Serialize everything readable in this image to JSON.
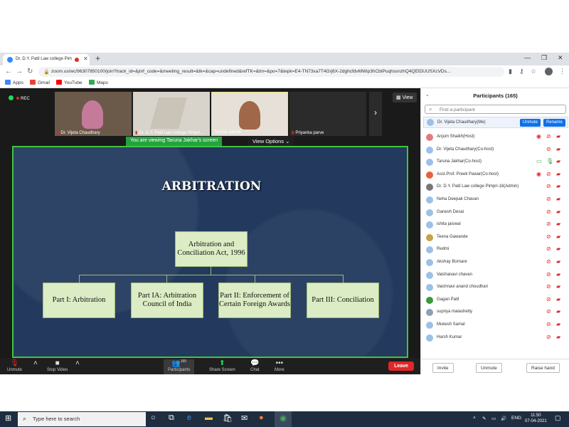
{
  "browser": {
    "tab_title": "Dr. D.Y. Patil Law college Pim",
    "new_tab": "+",
    "url": "zoom.us/wc/96307850100/join?track_id=&jmf_code=&meeting_result=&tk=&cap=undefined&refTK=&tm=&po=7&tepk=E4-TN73xa7T4Grj6X-2dghcfdvMWip3hCbtPuqhssnzhQ4QEIDUUSXcVDs...",
    "bookmarks": [
      "Apps",
      "Gmail",
      "YouTube",
      "Maps"
    ]
  },
  "meeting": {
    "rec_label": "REC",
    "view_label": "View",
    "viewing_banner": "You are viewing Taruna Jakhar's screen",
    "view_options": "View Options ⌄",
    "thumbnails": [
      {
        "name": "Dr. Vijeta Chaudhary"
      },
      {
        "name": "Dr. D.Y. Patil Law college Pimpri..."
      },
      {
        "name": "Taruna Jakhar"
      },
      {
        "name": "Priyanka parve"
      }
    ]
  },
  "slide": {
    "title": "ARBITRATION",
    "root": "Arbitration and Conciliation Act, 1996",
    "children": [
      "Part I:  Arbitration",
      "Part IA: Arbitration Council of India",
      "Part II: Enforcement of Certain Foreign Awards",
      "Part III: Conciliation"
    ]
  },
  "toolbar": {
    "unmute": "Unmute",
    "stop_video": "Stop Video",
    "participants": "Participants",
    "participants_count": "165",
    "share_screen": "Share Screen",
    "chat": "Chat",
    "more": "More",
    "leave": "Leave"
  },
  "panel": {
    "title": "Participants (165)",
    "search_placeholder": "Find a participant",
    "me": "Dr. Vijeta Chaudhary(Me)",
    "unmute_btn": "Unmute",
    "rename_btn": "Rename",
    "participants": [
      "Anjum Shaikh(Host)",
      "Dr. Vijeta Chaudhary(Co-host)",
      "Taruna Jakhar(Co-host)",
      "Asst.Prof. Preeti Pawar(Co-host)",
      "Dr. D.Y. Patil Law college Pimpri-18(Admin)",
      "Neha Deepak Chavan",
      "Ganesh Desai",
      "ishita jaiswal",
      "Teena Gawande",
      "Redmi",
      "Akshay Bornare",
      "Vaishanavi chavan",
      "Vaishnavi anand choudhari",
      "Gagan Patil",
      "supriya malashetty",
      "Mukesh Samal",
      "Harsh Kumar"
    ],
    "invite": "Invite",
    "unmute_all": "Unmute",
    "raise_hand": "Raise hand"
  },
  "taskbar": {
    "search_placeholder": "Type here to search",
    "lang": "ENG",
    "time": "11:50",
    "date": "07-04-2021"
  }
}
